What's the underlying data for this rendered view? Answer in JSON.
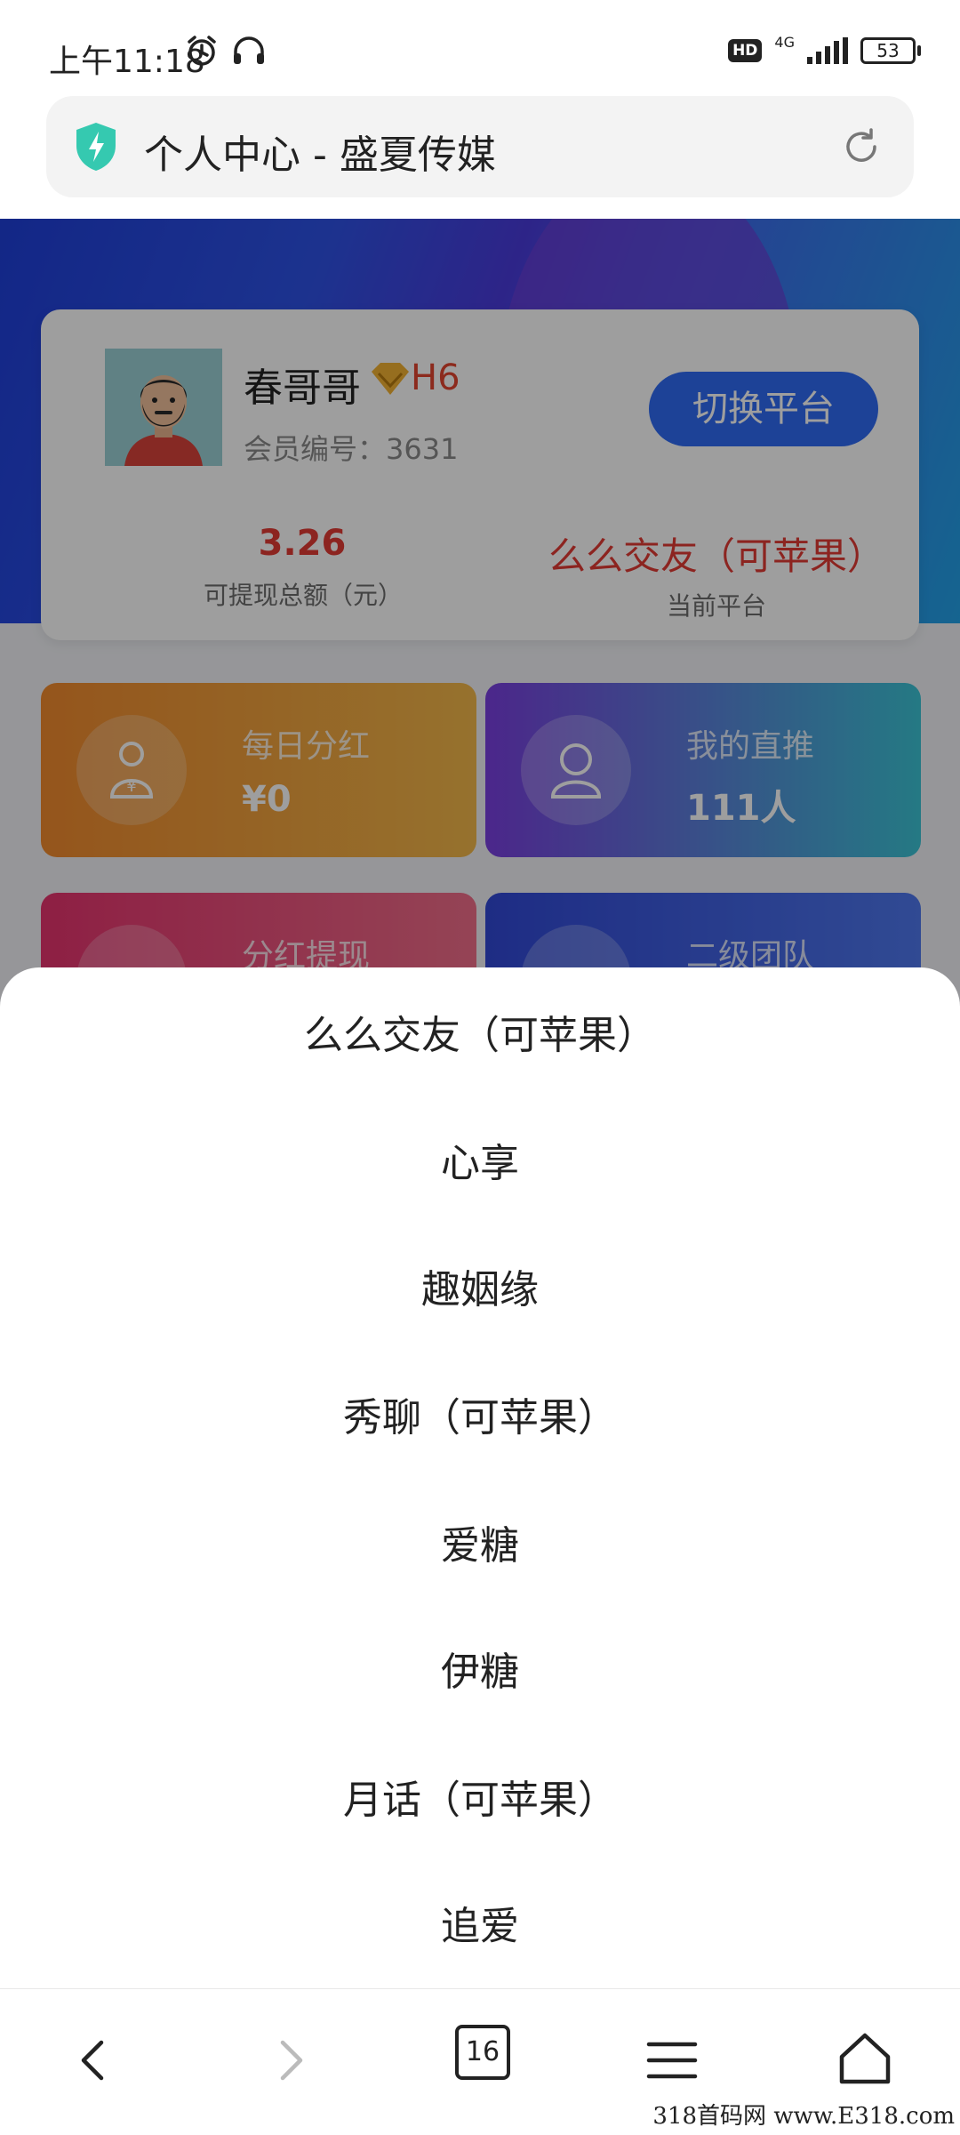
{
  "status_bar": {
    "time": "上午11:18",
    "hd": "HD",
    "network": "4G",
    "battery": "53"
  },
  "url_bar": {
    "title": "个人中心 - 盛夏传媒"
  },
  "profile": {
    "name": "春哥哥",
    "vip_level": "H6",
    "member_id": "会员编号：3631",
    "switch_button": "切换平台",
    "balance": "3.26",
    "balance_label": "可提现总额（元）",
    "platform": "么么交友（可苹果）",
    "platform_label": "当前平台"
  },
  "tiles": [
    {
      "label": "每日分红",
      "value": "¥0"
    },
    {
      "label": "我的直推",
      "value": "111人"
    },
    {
      "label": "分红提现",
      "value": ""
    },
    {
      "label": "二级团队",
      "value": ""
    }
  ],
  "sheet": {
    "items": [
      "么么交友（可苹果）",
      "心享",
      "趣姻缘",
      "秀聊（可苹果）",
      "爱糖",
      "伊糖",
      "月话（可苹果）",
      "追爱"
    ]
  },
  "navbar": {
    "tab_count": "16"
  },
  "watermark": "318首码网 www.E318.com",
  "colors": {
    "accent": "#2f6bf4",
    "highlight_red": "#e33b35"
  }
}
